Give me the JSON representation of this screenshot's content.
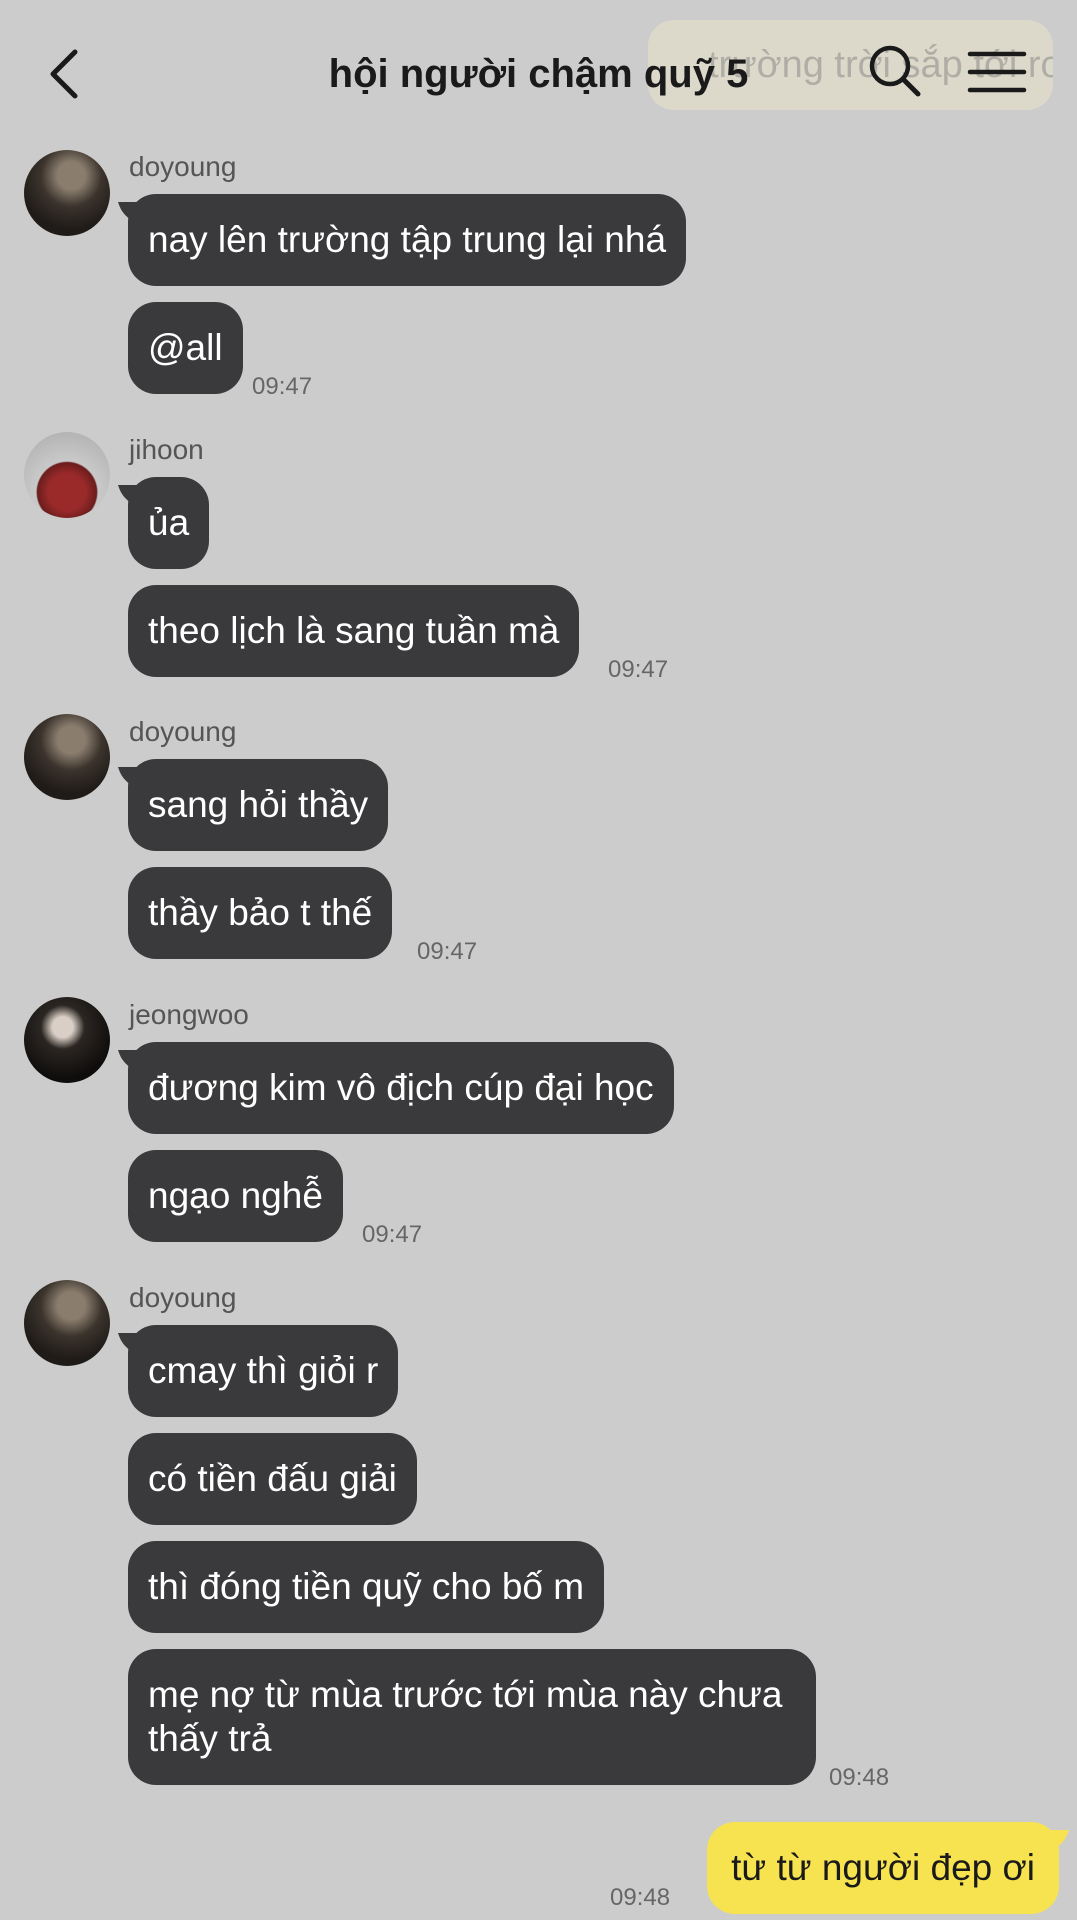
{
  "header": {
    "title": "hội người chậm quỹ 5",
    "ghost_banner": "trường trời sắp tới ro"
  },
  "messages": [
    {
      "sender": "doyoung",
      "texts": [
        "nay lên trường tập trung lại nhá",
        "@all"
      ],
      "time": "09:47"
    },
    {
      "sender": "jihoon",
      "texts": [
        "ủa",
        "theo lịch là sang tuần mà"
      ],
      "time": "09:47"
    },
    {
      "sender": "doyoung",
      "texts": [
        "sang hỏi thầy",
        "thầy bảo t thế"
      ],
      "time": "09:47"
    },
    {
      "sender": "jeongwoo",
      "texts": [
        "đương kim vô địch cúp đại học",
        "ngạo nghễ"
      ],
      "time": "09:47"
    },
    {
      "sender": "doyoung",
      "texts": [
        "cmay thì giỏi r",
        "có tiền đấu giải",
        "thì đóng tiền quỹ cho bố m",
        "mẹ nợ từ mùa trước tới mùa này chưa thấy trả"
      ],
      "time": "09:48"
    }
  ],
  "my_message": {
    "text": "từ từ người đẹp ơi",
    "time": "09:48"
  },
  "colors": {
    "background": "#cccccc",
    "incoming_bubble": "#3a3a3c",
    "outgoing_bubble": "#f7e350"
  },
  "icons": {
    "back": "chevron-left-icon",
    "search": "search-icon",
    "menu": "hamburger-menu-icon"
  }
}
